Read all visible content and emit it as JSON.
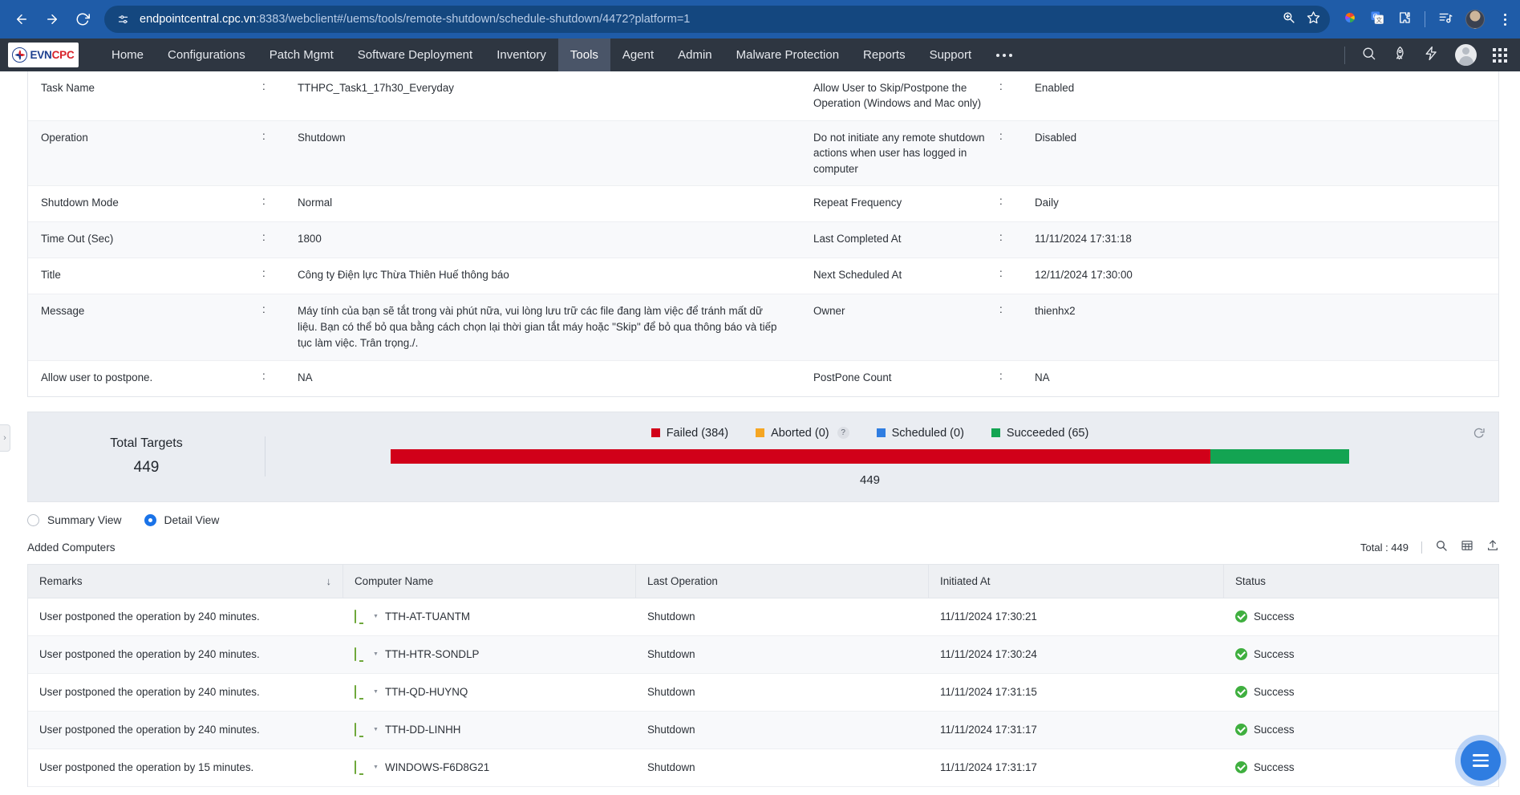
{
  "browser": {
    "back_icon": "back-arrow-icon",
    "forward_icon": "forward-arrow-icon",
    "reload_icon": "reload-icon",
    "site_info_icon": "site-settings-icon",
    "url_host": "endpointcentral.cpc.vn",
    "url_rest": ":8383/webclient#/uems/tools/remote-shutdown/schedule-shutdown/4472?platform=1",
    "zoom_icon": "zoom-search-icon",
    "bookmark_icon": "star-bookmark-icon",
    "extension_icons": [
      "color-wheel-icon",
      "google-translate-icon",
      "extensions-puzzle-icon",
      "media-playlist-icon"
    ],
    "profile_icon": "profile-avatar-icon",
    "menu_icon": "kebab-menu-icon"
  },
  "appnav": {
    "logo_evn": "EVN",
    "logo_cpc": "CPC",
    "items": [
      {
        "label": "Home",
        "active": false
      },
      {
        "label": "Configurations",
        "active": false
      },
      {
        "label": "Patch Mgmt",
        "active": false
      },
      {
        "label": "Software Deployment",
        "active": false
      },
      {
        "label": "Inventory",
        "active": false
      },
      {
        "label": "Tools",
        "active": true
      },
      {
        "label": "Agent",
        "active": false
      },
      {
        "label": "Admin",
        "active": false
      },
      {
        "label": "Malware Protection",
        "active": false
      },
      {
        "label": "Reports",
        "active": false
      },
      {
        "label": "Support",
        "active": false
      }
    ],
    "overflow_icon": "more-options-icon",
    "right_icons": [
      "search-icon",
      "rocket-icon",
      "lightning-bolt-icon",
      "user-avatar-icon",
      "apps-grid-icon"
    ]
  },
  "details": {
    "rows": [
      {
        "left_label": "Task Name",
        "left_value": "TTHPC_Task1_17h30_Everyday",
        "right_label": "Allow User to Skip/Postpone the Operation (Windows and Mac only)",
        "right_value": "Enabled"
      },
      {
        "left_label": "Operation",
        "left_value": "Shutdown",
        "right_label": "Do not initiate any remote shutdown actions when user has logged in computer",
        "right_value": "Disabled"
      },
      {
        "left_label": "Shutdown Mode",
        "left_value": "Normal",
        "right_label": "Repeat Frequency",
        "right_value": "Daily"
      },
      {
        "left_label": "Time Out (Sec)",
        "left_value": "1800",
        "right_label": "Last Completed At",
        "right_value": "11/11/2024 17:31:18"
      },
      {
        "left_label": "Title",
        "left_value": "Công ty Điện lực Thừa Thiên Huế thông báo",
        "right_label": "Next Scheduled At",
        "right_value": "12/11/2024 17:30:00"
      },
      {
        "left_label": "Message",
        "left_value": "Máy tính của bạn sẽ tắt trong vài phút nữa, vui lòng lưu trữ các file đang làm việc để tránh mất dữ liệu. Bạn có thể bỏ qua bằng cách chọn lại thời gian tắt máy hoặc \"Skip\" để bỏ qua thông báo và tiếp tục làm việc. Trân trọng./.",
        "right_label": "Owner",
        "right_value": "thienhx2"
      },
      {
        "left_label": "Allow user to postpone.",
        "left_value": "NA",
        "right_label": "PostPone Count",
        "right_value": "NA"
      }
    ],
    "colon": ":"
  },
  "summary": {
    "total_targets_label": "Total Targets",
    "total_targets_value": "449",
    "bar_total_label": "449",
    "refresh_icon": "refresh-icon",
    "help_icon": "?"
  },
  "chart_data": {
    "type": "bar",
    "title": "Total Targets",
    "orientation": "horizontal-stacked",
    "categories": [
      "Failed",
      "Aborted",
      "Scheduled",
      "Succeeded"
    ],
    "values": [
      384,
      0,
      0,
      65
    ],
    "labels": [
      "Failed (384)",
      "Aborted (0)",
      "Scheduled (0)",
      "Succeeded (65)"
    ],
    "colors": [
      "#d10019",
      "#f5a623",
      "#2f7de1",
      "#13a452"
    ],
    "total": 449,
    "total_label": "449",
    "legend_position": "top",
    "grid": false,
    "xlabel": "",
    "ylabel": ""
  },
  "view": {
    "summary_label": "Summary View",
    "detail_label": "Detail View",
    "selected": "Detail View"
  },
  "table": {
    "section_title": "Added Computers",
    "total_text": "Total : 449",
    "tool_icons": [
      "search-icon",
      "column-chooser-icon",
      "export-icon"
    ],
    "sort_icon": "↓",
    "columns": [
      "Remarks",
      "Computer Name",
      "Last Operation",
      "Initiated At",
      "Status"
    ],
    "rows": [
      {
        "remarks": "User postponed the operation by 240 minutes.",
        "computer": "TTH-AT-TUANTM",
        "operation": "Shutdown",
        "initiated": "11/11/2024 17:30:21",
        "status": "Success"
      },
      {
        "remarks": "User postponed the operation by 240 minutes.",
        "computer": "TTH-HTR-SONDLP",
        "operation": "Shutdown",
        "initiated": "11/11/2024 17:30:24",
        "status": "Success"
      },
      {
        "remarks": "User postponed the operation by 240 minutes.",
        "computer": "TTH-QD-HUYNQ",
        "operation": "Shutdown",
        "initiated": "11/11/2024 17:31:15",
        "status": "Success"
      },
      {
        "remarks": "User postponed the operation by 240 minutes.",
        "computer": "TTH-DD-LINHH",
        "operation": "Shutdown",
        "initiated": "11/11/2024 17:31:17",
        "status": "Success"
      },
      {
        "remarks": "User postponed the operation by 15 minutes.",
        "computer": "WINDOWS-F6D8G21",
        "operation": "Shutdown",
        "initiated": "11/11/2024 17:31:17",
        "status": "Success"
      }
    ]
  },
  "fab": {
    "icon": "hamburger-menu-icon"
  }
}
